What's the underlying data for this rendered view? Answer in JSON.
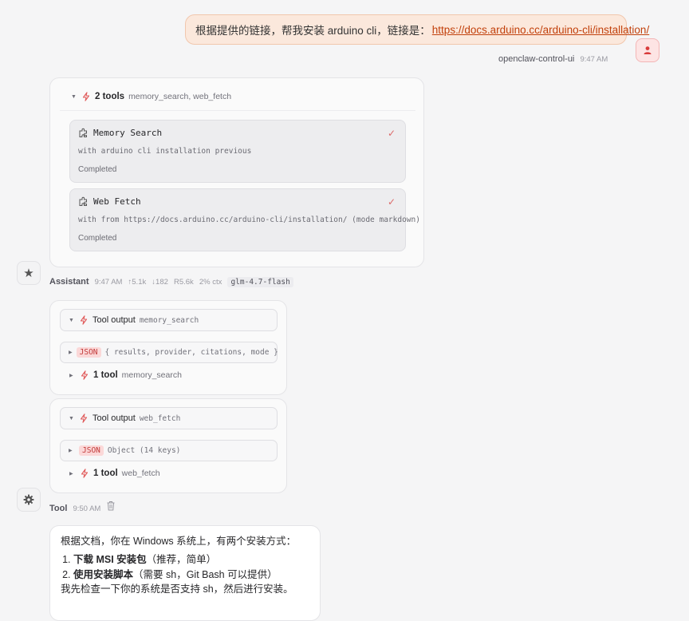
{
  "user_message": {
    "text": "根据提供的链接，帮我安装 arduino cli，链接是：",
    "link": "https://docs.arduino.cc/arduino-cli/installation/",
    "sender": "openclaw-control-ui",
    "time": "9:47 AM"
  },
  "tool_calls": {
    "summary_count": "2 tools",
    "summary_names": "memory_search, web_fetch",
    "items": [
      {
        "name": "Memory Search",
        "detail": "with arduino cli installation previous",
        "status": "Completed",
        "icon": "puzzle-icon"
      },
      {
        "name": "Web Fetch",
        "detail": "with from https://docs.arduino.cc/arduino-cli/installation/ (mode markdown)",
        "status": "Completed",
        "icon": "puzzle-icon"
      }
    ]
  },
  "assistant_meta": {
    "name": "Assistant",
    "time": "9:47 AM",
    "tokens_up": "↑5.1k",
    "tokens_down": "↓182",
    "reasoning": "R5.6k",
    "ctx": "2% ctx",
    "model": "glm-4.7-flash"
  },
  "tool_outputs": [
    {
      "label": "Tool output",
      "tool": "memory_search",
      "json_badge": "JSON",
      "json_preview": "{ results, provider, citations, mode }",
      "count_label": "1 tool",
      "count_tool": "memory_search"
    },
    {
      "label": "Tool output",
      "tool": "web_fetch",
      "json_badge": "JSON",
      "json_preview": "Object (14 keys)",
      "count_label": "1 tool",
      "count_tool": "web_fetch"
    }
  ],
  "tool_meta": {
    "name": "Tool",
    "time": "9:50 AM",
    "icon": "trash-icon"
  },
  "answer": {
    "intro": "根据文档，你在 Windows 系统上，有两个安装方式：",
    "items": [
      {
        "bold": "下载 MSI 安装包",
        "rest": "（推荐，简单）"
      },
      {
        "bold": "使用安装脚本",
        "rest": "（需要 sh，Git Bash 可以提供）"
      }
    ],
    "outro": "我先检查一下你的系统是否支持 sh，然后进行安装。"
  },
  "colors": {
    "accent": "#e05a5a",
    "user_bubble": "#fbe8dc",
    "link": "#c2410c"
  }
}
